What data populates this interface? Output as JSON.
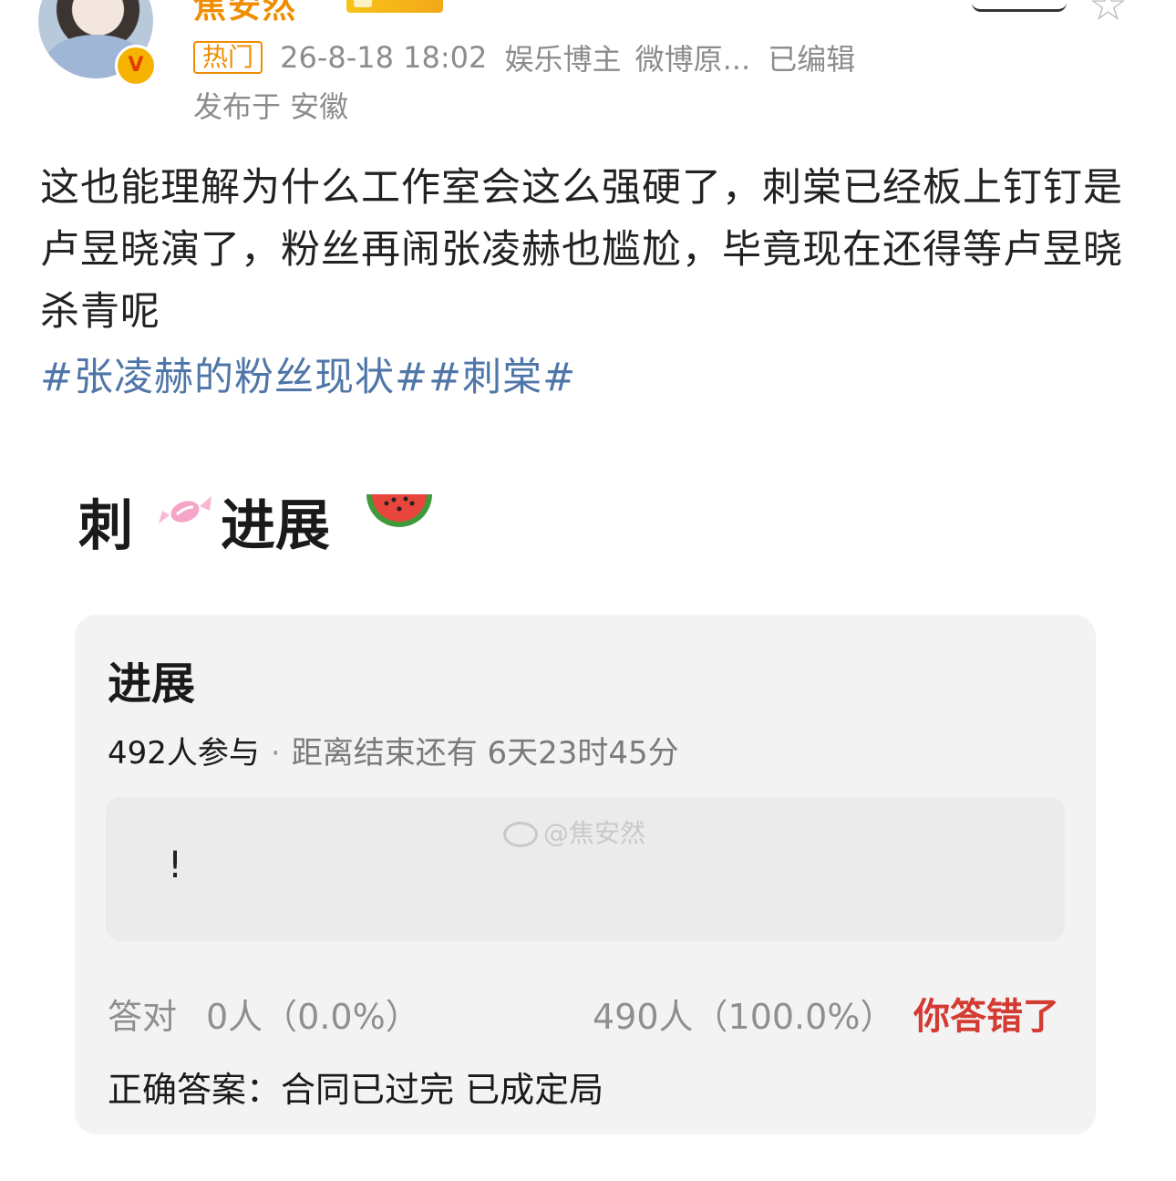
{
  "header": {
    "username": "焦安然",
    "verified_badge": "V",
    "hot_tag": "热门",
    "timestamp": "26-8-18 18:02",
    "category": "娱乐博主",
    "source": "微博原...",
    "edited": "已编辑",
    "location": "发布于 安徽"
  },
  "post": {
    "text": "这也能理解为什么工作室会这么强硬了，刺棠已经板上钉钉是卢昱晓演了，粉丝再闹张凌赫也尴尬，毕竟现在还得等卢昱晓杀青呢",
    "hashtags": "#张凌赫的粉丝现状##刺棠#"
  },
  "embed": {
    "title_part1": "刺",
    "title_part2": "进展",
    "card": {
      "title": "进展",
      "participants": "492人参与",
      "separator": "·",
      "timer": "距离结束还有 6天23时45分",
      "answer_text": "!",
      "watermark": "@焦安然",
      "correct_label": "答对",
      "correct_count": "0人（0.0%）",
      "wrong_count": "490人（100.0%）",
      "wrong_label": "你答错了",
      "correct_answer": "正确答案：合同已过完 已成定局"
    }
  },
  "icons": {
    "candy": "candy-icon",
    "watermelon": "watermelon-icon",
    "star": "star-icon",
    "verified": "verified-v-icon"
  },
  "colors": {
    "accent_orange": "#f08c00",
    "hashtag_blue": "#4f76a8",
    "wrong_red": "#d43b32",
    "meta_gray": "#8c8c8c"
  }
}
